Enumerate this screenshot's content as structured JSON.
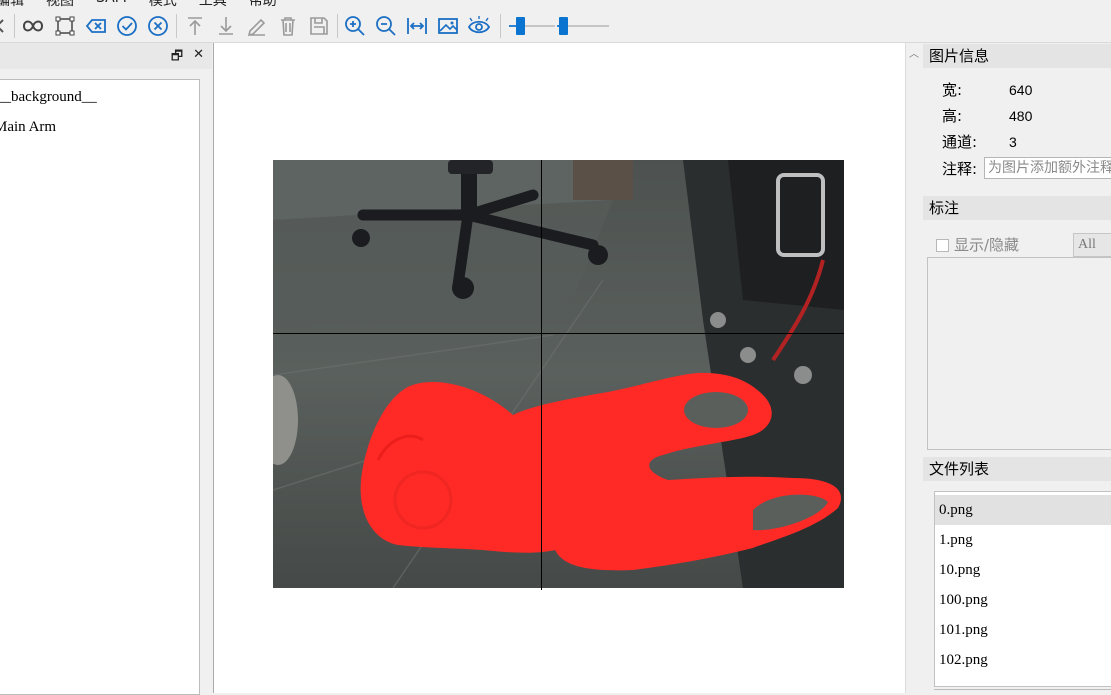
{
  "menubar": {
    "items": [
      "编辑",
      "视图",
      "SAM",
      "模式",
      "工具",
      "帮助"
    ]
  },
  "toolbar": {
    "icons": [
      "arrow-left-icon",
      "polygon-icon",
      "rectangle-icon",
      "delete-icon",
      "confirm-icon",
      "cancel-icon",
      "move-top-icon",
      "move-bottom-icon",
      "edit-icon",
      "trash-icon",
      "save-icon",
      "zoom-in-icon",
      "zoom-out-icon",
      "fit-width-icon",
      "image-icon",
      "eye-icon"
    ],
    "slider1_level": 0.2,
    "slider2_level": 0.05
  },
  "left_panel": {
    "labels": [
      "__background__",
      "Main Arm"
    ]
  },
  "right_panel": {
    "image_info_title": "图片信息",
    "width_label": "宽:",
    "width_value": "640",
    "height_label": "高:",
    "height_value": "480",
    "channels_label": "通道:",
    "channels_value": "3",
    "note_label": "注释:",
    "note_placeholder": "为图片添加额外注释",
    "annotations_title": "标注",
    "show_hide_label": "显示/隐藏",
    "filter_value": "All",
    "file_list_title": "文件列表",
    "files": [
      "0.png",
      "1.png",
      "10.png",
      "100.png",
      "101.png",
      "102.png"
    ]
  },
  "colors": {
    "mask": "#ff2a26",
    "accent": "#0a74d0"
  }
}
